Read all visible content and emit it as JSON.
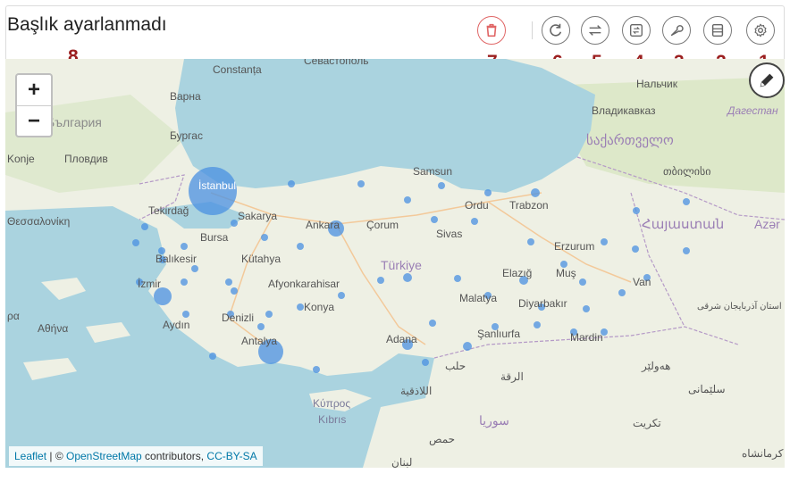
{
  "panel": {
    "title": "Başlık ayarlanmadı"
  },
  "toolbar": {
    "buttons": [
      {
        "name": "delete-button",
        "icon": "trash-icon"
      },
      {
        "name": "refresh-button",
        "icon": "refresh-icon"
      },
      {
        "name": "swap-button",
        "icon": "swap-icon"
      },
      {
        "name": "repeat-button",
        "icon": "repeat-icon"
      },
      {
        "name": "wrench-button",
        "icon": "wrench-icon"
      },
      {
        "name": "list-button",
        "icon": "list-icon"
      },
      {
        "name": "settings-button",
        "icon": "gear-icon"
      }
    ]
  },
  "annotations": [
    "1",
    "2",
    "3",
    "4",
    "5",
    "6",
    "7",
    "8"
  ],
  "map": {
    "zoom_in": "+",
    "zoom_out": "−",
    "labels": {
      "constanta": "Constanța",
      "sevastopol": "Севастополь",
      "varna": "Варна",
      "bulgaria": "България",
      "burgas": "Бургас",
      "plovdiv": "Пловдив",
      "konje": "Konje",
      "nalchik": "Нальчик",
      "vladikavkaz": "Владикавказ",
      "dagestan": "Дагестан",
      "georgia": "საქართველო",
      "tbilisi": "თბილისი",
      "istanbul": "İstanbul",
      "samsun": "Samsun",
      "thessaloniki": "Θεσσαλονίκη",
      "tekirdag": "Tekirdağ",
      "sakarya": "Sakarya",
      "ankara": "Ankara",
      "corum": "Çorum",
      "ordu": "Ordu",
      "trabzon": "Trabzon",
      "armenia": "Հայաստան",
      "azer": "Azər",
      "bursa": "Bursa",
      "sivas": "Sivas",
      "erzurum": "Erzurum",
      "balikesir": "Balıkesir",
      "kutahya": "Kütahya",
      "turkiye": "Türkiye",
      "elazig": "Elazığ",
      "mus": "Muş",
      "izmir": "İzmir",
      "afyon": "Afyonkarahisar",
      "malatya": "Malatya",
      "van": "Van",
      "diyarbakir": "Diyarbakır",
      "azerbaijan_east": "استان آذربایجان شرقی",
      "athina": "Αθήνα",
      "aydin": "Aydın",
      "denizli": "Denizli",
      "konya": "Konya",
      "ra": "ρα",
      "adana": "Adana",
      "sanliurfa": "Şanlıurfa",
      "mardin": "Mardin",
      "antalya": "Antalya",
      "halab": "حلب",
      "raqqa": "الرقة",
      "hewler": "هەولێر",
      "sulaimani": "سلێمانی",
      "latakia": "اللاذقية",
      "kypros": "Κύπρος",
      "kibris": "Kıbrıs",
      "suriya": "سوريا",
      "tikrit": "تكريت",
      "homs": "حمص",
      "kermanshah": "کرمانشاه",
      "lubnan": "لبنان"
    },
    "attribution": {
      "leaflet": "Leaflet",
      "sep": " | © ",
      "osm": "OpenStreetMap",
      "contrib": " contributors, ",
      "license": "CC-BY-SA"
    }
  }
}
